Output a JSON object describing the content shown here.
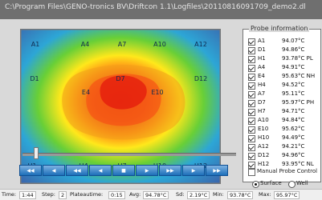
{
  "window": {
    "title": "C:\\Program Files\\GENO-tronics BV\\Driftcon 1.1\\Logfiles\\20110816091709_demo2.dl"
  },
  "heatmap": {
    "labels": [
      "A1",
      "A4",
      "A7",
      "A10",
      "A12",
      "D1",
      "D7",
      "D12",
      "E4",
      "E10",
      "H1",
      "H4",
      "H7",
      "H10",
      "H12"
    ]
  },
  "probe_panel": {
    "title": "Probe information",
    "probes": [
      {
        "id": "A1",
        "value": "94.07°C"
      },
      {
        "id": "D1",
        "value": "94.86°C"
      },
      {
        "id": "H1",
        "value": "93.78°C PL"
      },
      {
        "id": "A4",
        "value": "94.91°C"
      },
      {
        "id": "E4",
        "value": "95.63°C NH"
      },
      {
        "id": "H4",
        "value": "94.52°C"
      },
      {
        "id": "A7",
        "value": "95.11°C"
      },
      {
        "id": "D7",
        "value": "95.97°C PH"
      },
      {
        "id": "H7",
        "value": "94.71°C"
      },
      {
        "id": "A10",
        "value": "94.84°C"
      },
      {
        "id": "E10",
        "value": "95.62°C"
      },
      {
        "id": "H10",
        "value": "94.49°C"
      },
      {
        "id": "A12",
        "value": "94.21°C"
      },
      {
        "id": "D12",
        "value": "94.96°C"
      },
      {
        "id": "H12",
        "value": "93.95°C NL"
      }
    ]
  },
  "options": {
    "manual_probe_control": "Manual Probe Control",
    "surface": "Surface",
    "well": "Well"
  },
  "status": {
    "time_label": "Time:",
    "time_value": "1:44",
    "step_label": "Step:",
    "step_value": "2",
    "plateau_label": "Plateautime:",
    "plateau_value": "0:15",
    "avg_label": "Avg:",
    "avg_value": "94.78°C",
    "sd_label": "Sd:",
    "sd_value": "2.19°C",
    "min_label": "Min:",
    "min_value": "93.78°C",
    "max_label": "Max:",
    "max_value": "95.97°C"
  },
  "playback": {
    "position_fraction": 0.06
  }
}
